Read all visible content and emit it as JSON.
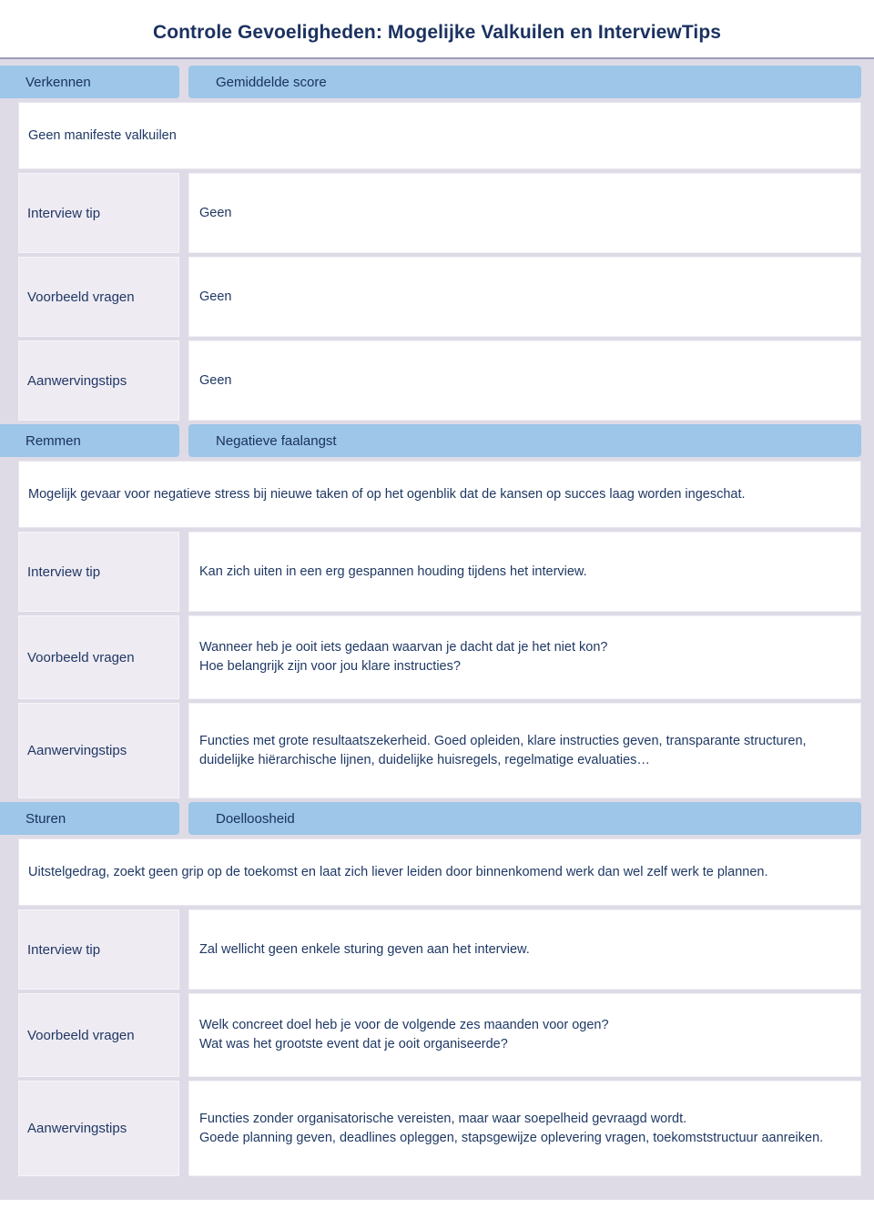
{
  "document": {
    "title": "Controle Gevoeligheden: Mogelijke Valkuilen en InterviewTips"
  },
  "colors": {
    "title_text": "#1b3260",
    "section_header_bg": "#9dc6e8",
    "label_cell_bg": "#efebf3",
    "table_bg": "#dedbe6",
    "body_text": "#1f3864"
  },
  "sections": [
    {
      "category": "Verkennen",
      "trait": "Gemiddelde score",
      "description": "Geen manifeste valkuilen",
      "rows": [
        {
          "label": "Interview tip",
          "value": "Geen"
        },
        {
          "label": "Voorbeeld vragen",
          "value": "Geen"
        },
        {
          "label": "Aanwervingstips",
          "value": "Geen"
        }
      ]
    },
    {
      "category": "Remmen",
      "trait": "Negatieve faalangst",
      "description": "Mogelijk gevaar voor negatieve stress bij nieuwe taken of op het ogenblik dat de kansen op succes laag worden ingeschat.",
      "rows": [
        {
          "label": "Interview tip",
          "value": "Kan zich uiten in een erg gespannen houding tijdens het interview."
        },
        {
          "label": "Voorbeeld vragen",
          "value": "Wanneer heb je ooit iets gedaan waarvan je dacht dat je het niet kon?\nHoe belangrijk zijn voor jou klare instructies?"
        },
        {
          "label": "Aanwervingstips",
          "value": "Functies met grote resultaatszekerheid. Goed opleiden, klare instructies geven, transparante structuren, duidelijke hiërarchische lijnen, duidelijke huisregels, regelmatige evaluaties…"
        }
      ]
    },
    {
      "category": "Sturen",
      "trait": "Doelloosheid",
      "description": "Uitstelgedrag, zoekt geen grip op de toekomst en laat zich liever leiden door binnenkomend werk dan wel zelf werk te plannen.",
      "rows": [
        {
          "label": "Interview tip",
          "value": "Zal wellicht geen enkele sturing geven aan het interview."
        },
        {
          "label": "Voorbeeld vragen",
          "value": "Welk concreet doel heb je voor de volgende zes maanden voor ogen?\nWat was het grootste event dat je ooit organiseerde?"
        },
        {
          "label": "Aanwervingstips",
          "value": "Functies zonder organisatorische vereisten, maar waar soepelheid gevraagd wordt.\nGoede planning geven, deadlines opleggen, stapsgewijze oplevering vragen, toekomststructuur aanreiken."
        }
      ]
    }
  ]
}
